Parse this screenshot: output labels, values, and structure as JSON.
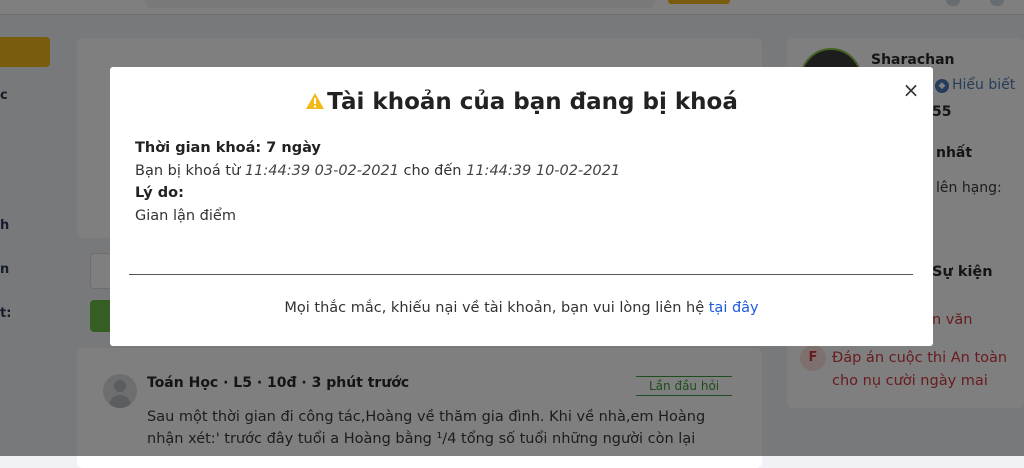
{
  "background": {
    "sidebar_fragments": [
      "c",
      "h",
      "n",
      "t:"
    ],
    "right_panel": {
      "name": "Sharachan",
      "badge": "Hiểu biết",
      "points": "55",
      "rank_heading": "nhất",
      "rank_text": "lên hạng:",
      "events_heading": "Sự kiện",
      "event_item_1": "n văn",
      "event_item_2_line1": "Đáp án cuộc thi An toàn",
      "event_item_2_line2": "cho nụ cười ngày mai"
    },
    "post": {
      "meta": "Toán Học · L5 · 10đ · 3 phút trước",
      "tag": "Lần đầu hỏi",
      "line1": "Sau một thời gian đi công tác,Hoàng về thăm gia đình. Khi về nhà,em Hoàng",
      "line2": "nhận xét:' trước đây tuổi a Hoàng bằng ¹/4 tổng số tuổi những người còn lại"
    }
  },
  "modal": {
    "title": "Tài khoản của bạn đang bị khoá",
    "lock_duration_label": "Thời gian khoá: 7 ngày",
    "locked_from_prefix": "Bạn bị khoá từ",
    "locked_from": "11:44:39 03-02-2021",
    "locked_until_prefix": "cho đến",
    "locked_until": "11:44:39 10-02-2021",
    "reason_label": "Lý do:",
    "reason": "Gian lận điểm",
    "footer_text": "Mọi thắc mắc, khiếu nại về tài khoản, bạn vui lòng liên hệ",
    "footer_link": "tại đây",
    "close_symbol": "×"
  },
  "icons": {
    "warning": "warning-icon",
    "close": "close-icon",
    "shield": "shield-icon",
    "flag": "flag-icon"
  },
  "colors": {
    "overlay": "#000000",
    "warning": "#f3b81a",
    "link": "#1e5be0",
    "accent_yellow": "#f3b81a",
    "green": "#6dba49",
    "event_red": "#d0393e"
  }
}
